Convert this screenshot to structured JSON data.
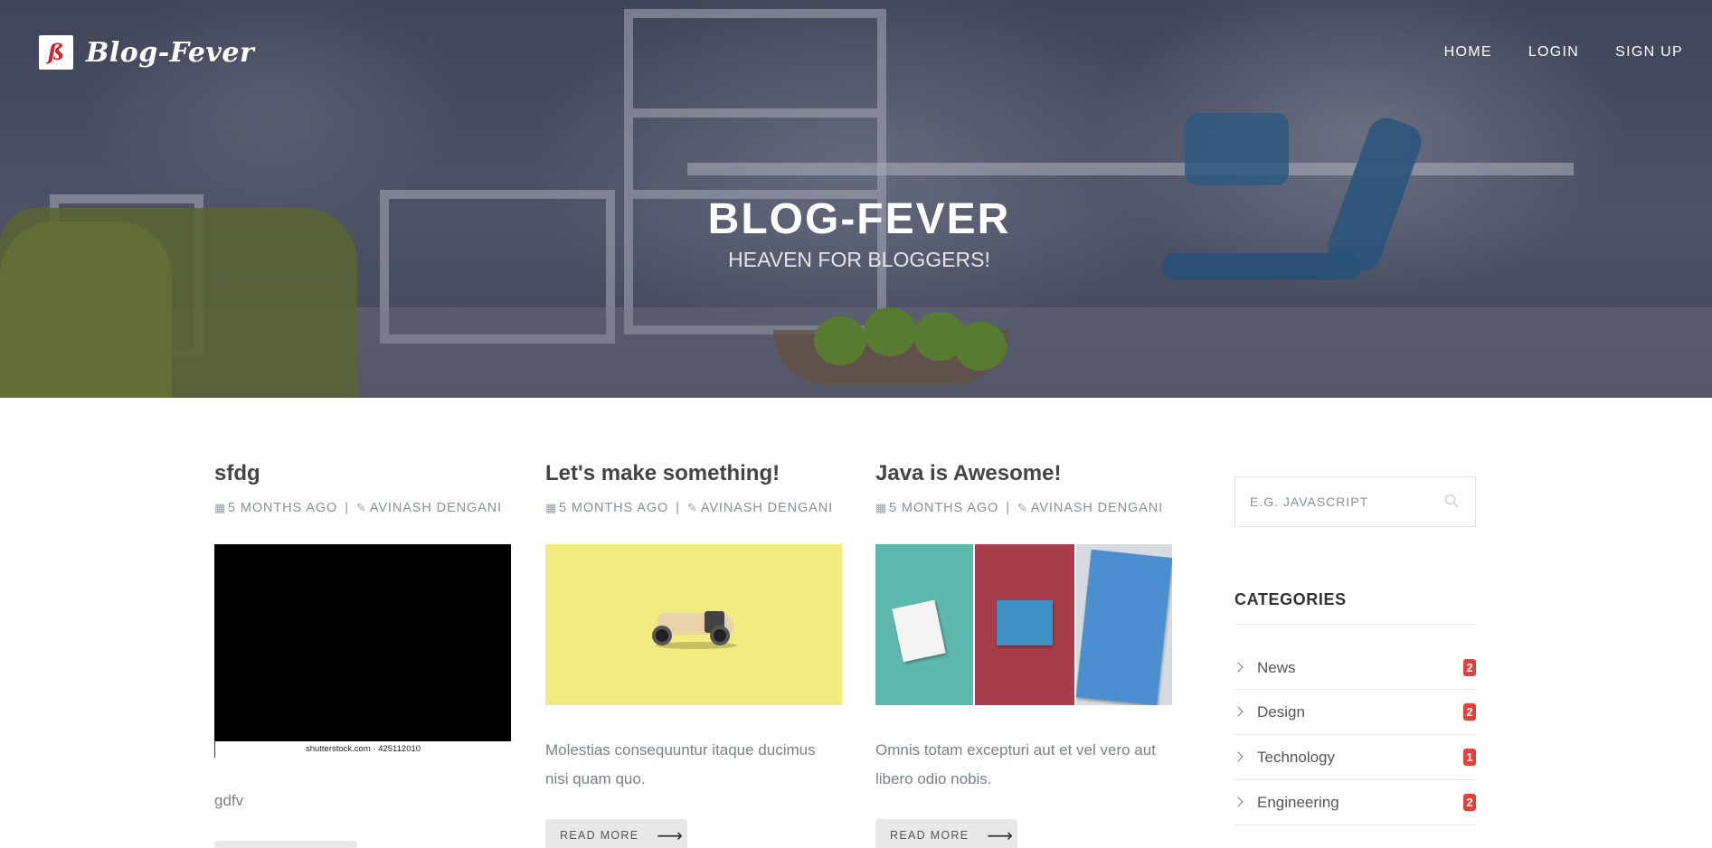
{
  "brand": {
    "logo_letter": "ß",
    "name": "Blog-Fever"
  },
  "nav": {
    "home": "HOME",
    "login": "LOGIN",
    "signup": "SIGN UP"
  },
  "hero": {
    "title": "BLOG-FEVER",
    "subtitle": "HEAVEN FOR BLOGGERS!"
  },
  "posts": [
    {
      "title": "sfdg",
      "date": "5 MONTHS AGO",
      "separator": "|",
      "author": "AVINASH DENGANI",
      "image_caption": "shutterstock.com · 425112010",
      "excerpt": "gdfv",
      "read_more": ""
    },
    {
      "title": "Let's make something!",
      "date": "5 MONTHS AGO",
      "separator": "|",
      "author": "AVINASH DENGANI",
      "excerpt": "Molestias consequuntur itaque ducimus nisi quam quo.",
      "read_more": "READ MORE"
    },
    {
      "title": "Java is Awesome!",
      "date": "5 MONTHS AGO",
      "separator": "|",
      "author": "AVINASH DENGANI",
      "excerpt": "Omnis totam excepturi aut et vel vero aut libero odio nobis.",
      "read_more": "READ MORE"
    }
  ],
  "sidebar": {
    "search": {
      "placeholder": "E.G. JAVASCRIPT",
      "value": ""
    },
    "categories_heading": "CATEGORIES",
    "categories": [
      {
        "label": "News",
        "count": "2"
      },
      {
        "label": "Design",
        "count": "2"
      },
      {
        "label": "Technology",
        "count": "1"
      },
      {
        "label": "Engineering",
        "count": "2"
      }
    ]
  },
  "colors": {
    "badge": "#e2413b",
    "hero_overlay": "#2a2c3c",
    "button_bg": "#e8e8ea"
  },
  "icons": [
    "calendar-icon",
    "pencil-icon",
    "search-icon",
    "chevron-right-icon",
    "arrow-right-icon"
  ]
}
